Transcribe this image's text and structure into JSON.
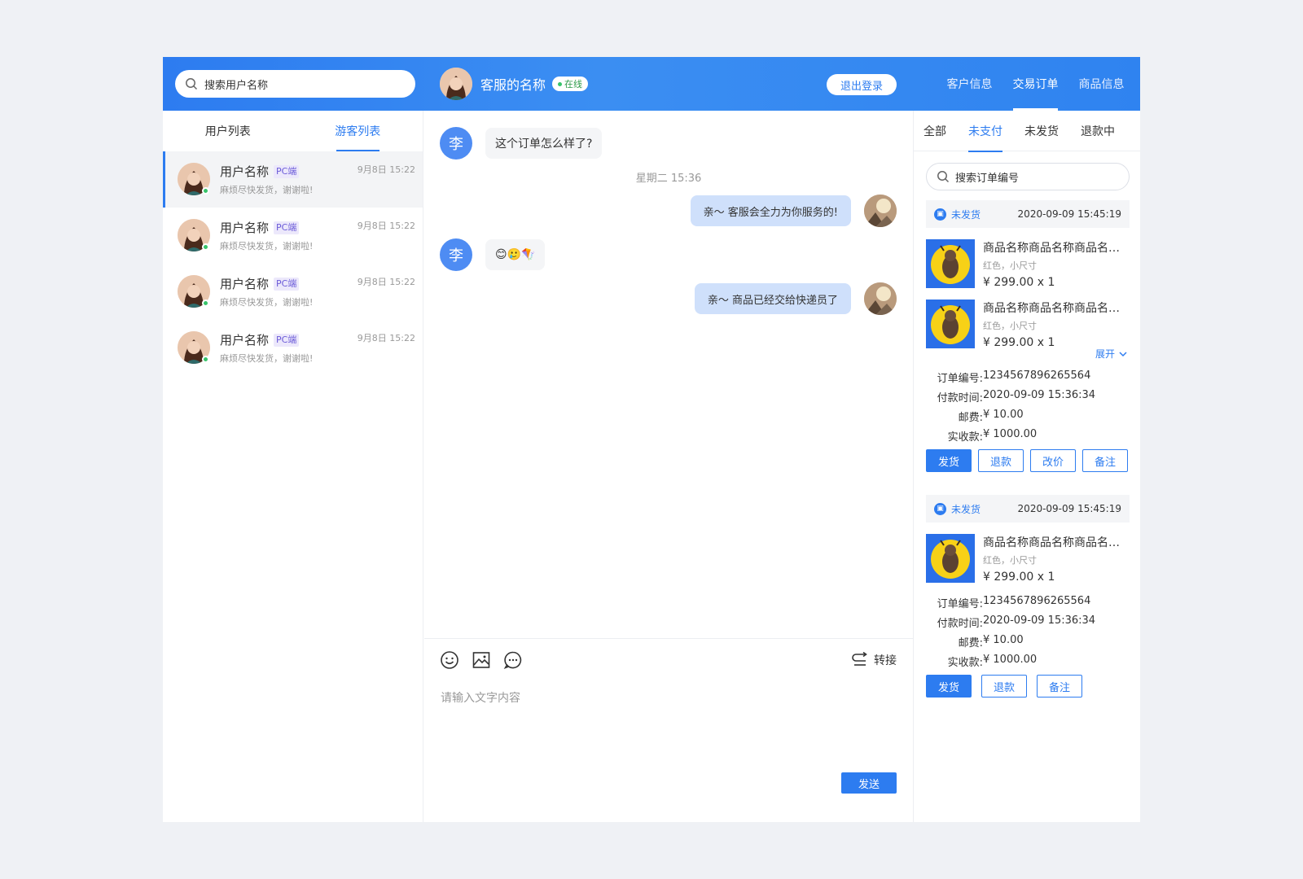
{
  "header": {
    "search_placeholder": "搜索用户名称",
    "agent_name": "客服的名称",
    "online_badge": "在线",
    "logout": "退出登录",
    "nav": [
      "客户信息",
      "交易订单",
      "商品信息"
    ],
    "nav_active_index": 1
  },
  "left": {
    "tabs": [
      "用户列表",
      "游客列表"
    ],
    "active_tab": 1,
    "users": [
      {
        "name": "用户名称",
        "tag": "PC端",
        "message": "麻烦尽快发货，谢谢啦!",
        "time": "9月8日 15:22"
      },
      {
        "name": "用户名称",
        "tag": "PC端",
        "message": "麻烦尽快发货，谢谢啦!",
        "time": "9月8日 15:22"
      },
      {
        "name": "用户名称",
        "tag": "PC端",
        "message": "麻烦尽快发货，谢谢啦!",
        "time": "9月8日 15:22"
      },
      {
        "name": "用户名称",
        "tag": "PC端",
        "message": "麻烦尽快发货，谢谢啦!",
        "time": "9月8日 15:22"
      }
    ]
  },
  "chat": {
    "avatar_char": "李",
    "msg1": "这个订单怎么样了?",
    "time_separator": "星期二 15:36",
    "msg2": "亲～ 客服会全力为你服务的!",
    "msg3": "😊🥲🪁",
    "msg4": "亲～ 商品已经交给快递员了",
    "transfer": "转接",
    "input_placeholder": "请输入文字内容",
    "send": "发送"
  },
  "orders": {
    "tabs": [
      "全部",
      "未支付",
      "未发货",
      "退款中"
    ],
    "active_tab": 1,
    "search_placeholder": "搜索订单编号",
    "expand": "展开",
    "order1": {
      "status": "未发货",
      "date": "2020-09-09 15:45:19",
      "products": [
        {
          "name": "商品名称商品名称商品名称商品名称",
          "spec": "红色，小尺寸",
          "price": "¥ 299.00 x 1"
        },
        {
          "name": "商品名称商品名称商品名称商品名称",
          "spec": "红色，小尺寸",
          "price": "¥ 299.00 x 1"
        }
      ],
      "order_no_label": "订单编号:",
      "order_no": "1234567896265564",
      "pay_time_label": "付款时间:",
      "pay_time": "2020-09-09 15:36:34",
      "postage_label": "邮费:",
      "postage": "¥ 10.00",
      "paid_label": "实收款:",
      "paid": "¥ 1000.00",
      "buttons": [
        "发货",
        "退款",
        "改价",
        "备注"
      ]
    },
    "order2": {
      "status": "未发货",
      "date": "2020-09-09 15:45:19",
      "products": [
        {
          "name": "商品名称商品名称商品名称商品名称",
          "spec": "红色，小尺寸",
          "price": "¥ 299.00 x 1"
        }
      ],
      "order_no_label": "订单编号:",
      "order_no": "1234567896265564",
      "pay_time_label": "付款时间:",
      "pay_time": "2020-09-09 15:36:34",
      "postage_label": "邮费:",
      "postage": "¥ 10.00",
      "paid_label": "实收款:",
      "paid": "¥ 1000.00",
      "buttons": [
        "发货",
        "退款",
        "备注"
      ]
    }
  },
  "colors": {
    "primary": "#2d7cf0",
    "online": "#37c46a",
    "tag": "#6b5bd8"
  }
}
